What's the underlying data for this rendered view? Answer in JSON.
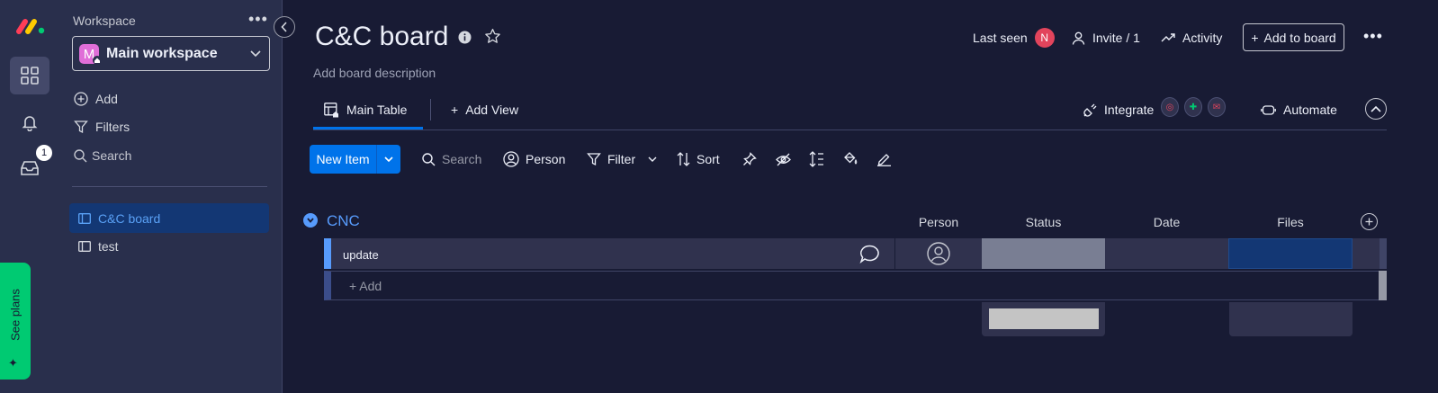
{
  "sidebar": {
    "workspace_label": "Workspace",
    "workspace_more": "•••",
    "workspace_avatar": "M",
    "workspace_name": "Main workspace",
    "actions": {
      "add": "Add",
      "filters": "Filters",
      "search": "Search"
    },
    "boards": [
      {
        "label": "C&C board",
        "active": true
      },
      {
        "label": "test",
        "active": false
      }
    ]
  },
  "rail": {
    "inbox_badge": "1",
    "see_plans": "See plans"
  },
  "header": {
    "title": "C&C board",
    "description": "Add board description",
    "last_seen_label": "Last seen",
    "last_seen_avatar": "N",
    "invite_label": "Invite / 1",
    "activity_label": "Activity",
    "add_to_board_label": "Add to board",
    "more": "•••"
  },
  "tabs": {
    "main_table": "Main Table",
    "add_view": "Add View",
    "integrate": "Integrate",
    "automate": "Automate"
  },
  "toolbar": {
    "new_item": "New Item",
    "search_placeholder": "Search",
    "person": "Person",
    "filter": "Filter",
    "sort": "Sort"
  },
  "group": {
    "title": "CNC",
    "color": "#579bfc",
    "columns": {
      "person": "Person",
      "status": "Status",
      "date": "Date",
      "files": "Files"
    },
    "rows": [
      {
        "name": "update",
        "status": "",
        "date": "",
        "files": ""
      }
    ],
    "add_row_label": "+ Add"
  },
  "colors": {
    "background": "#181b34",
    "sidebar": "#292f4c",
    "accent": "#0073ea",
    "see_plans": "#00ca72",
    "avatar_workspace": "#e06ed8",
    "avatar_user": "#e2445c"
  }
}
